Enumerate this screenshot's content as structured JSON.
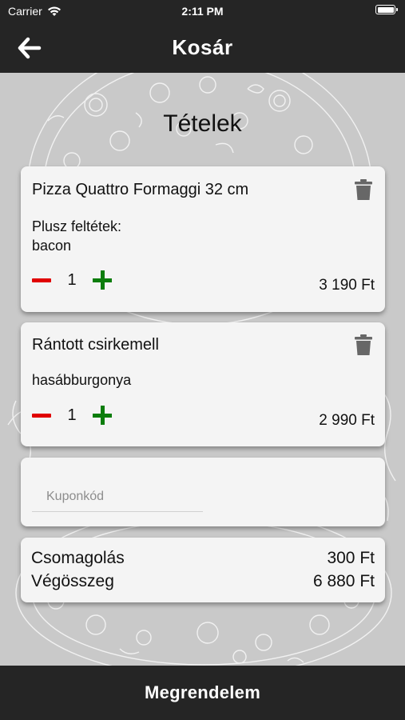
{
  "status_bar": {
    "carrier": "Carrier",
    "time": "2:11 PM"
  },
  "nav": {
    "title": "Kosár"
  },
  "section_title": "Tételek",
  "items": [
    {
      "name": "Pizza Quattro Formaggi 32 cm",
      "extras_label": "Plusz feltétek:",
      "extras": "bacon",
      "quantity": "1",
      "price": "3 190 Ft"
    },
    {
      "name": "Rántott csirkemell",
      "extras": "hasábburgonya",
      "quantity": "1",
      "price": "2 990 Ft"
    }
  ],
  "coupon": {
    "placeholder": "Kuponkód"
  },
  "summary": {
    "packaging_label": "Csomagolás",
    "packaging_value": "300 Ft",
    "total_label": "Végösszeg",
    "total_value": "6 880 Ft"
  },
  "footer": {
    "order_label": "Megrendelem"
  },
  "colors": {
    "bar": "#252525",
    "minus": "#e00000",
    "plus": "#0c7d0c",
    "card": "#f4f4f4",
    "background": "#c9c9c9"
  }
}
